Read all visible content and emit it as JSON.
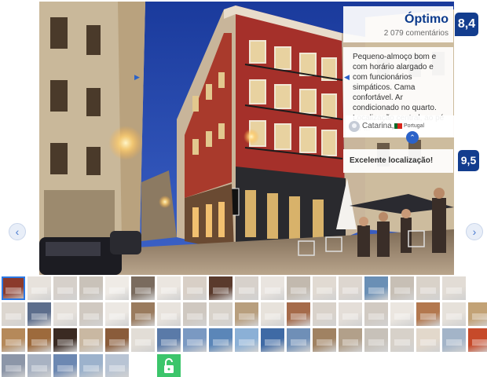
{
  "review": {
    "rating_label": "Óptimo",
    "review_count": "2 079 comentários",
    "score": "8,4",
    "text": "Pequeno-almoço bom e com horário alargado e com funcionários simpáticos. Cama confortável. Ar condicionado no quarto. Localização central, ao pé de ...",
    "reviewer_name": "Catarina,",
    "reviewer_country": "Portugal"
  },
  "highlight": {
    "label": "Excelente localização!",
    "score": "9,5"
  },
  "icons": {
    "prev": "chevron-left-icon",
    "next": "chevron-right-icon",
    "collapse": "chevron-up-icon",
    "lock": "unlock-icon"
  },
  "colors": {
    "score_badge": "#133d8e",
    "title": "#0b3a8c",
    "link": "#2b62c8",
    "lock": "#3cc56b",
    "selected": "#2b78e4"
  },
  "gallery": {
    "selected_index": 0,
    "thumbnail_count": 62,
    "thumbs": [
      "#8b3a2c",
      "#e7e2dc",
      "#d6d0ca",
      "#c9c2b9",
      "#efebe6",
      "#7a6b5e",
      "#ebe6e0",
      "#d8cfc6",
      "#5a3a2c",
      "#d7d1cb",
      "#e9e4df",
      "#c2b9ae",
      "#e1dad2",
      "#ddd6cf",
      "#6a8fb5",
      "#c7bfb5",
      "#d9d2c9",
      "#e2dcd5",
      "#dcd6cf",
      "#5d6e8c",
      "#e5e0da",
      "#d0c9c1",
      "#ece8e3",
      "#9a7b5e",
      "#e8e3dd",
      "#cfc8c0",
      "#d8d2ca",
      "#b89f7e",
      "#e7e2db",
      "#a56b4a",
      "#d9d2ca",
      "#e4ded8",
      "#d1cac2",
      "#ebe6e0",
      "#b3784e",
      "#e6e1da",
      "#c2a276",
      "#b5895a",
      "#9d6a3c",
      "#3a2a22",
      "#c9b8a2",
      "#8a5c3a",
      "#e2ddd6",
      "#5a7aa8",
      "#7a99c2",
      "#5b86b8",
      "#8bb0d6",
      "#3f6aa5",
      "#6f8fb7",
      "#a08262",
      "#b2a08a",
      "#c7c1b9",
      "#d7d1c9",
      "#e2d8cb",
      "#a3b4c8",
      "#c64a2a",
      "#8c96a8",
      "#a8b2c2",
      "#6c88b2",
      "#9cb2cc",
      "#b8c4d4"
    ]
  }
}
